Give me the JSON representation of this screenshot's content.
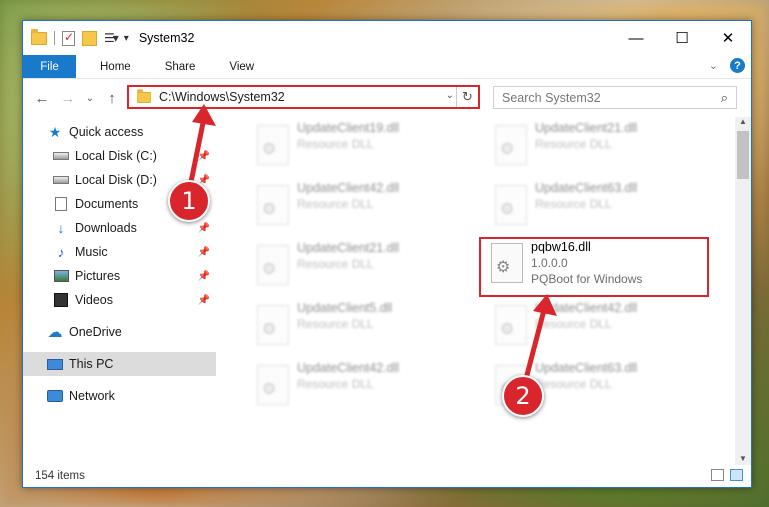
{
  "window": {
    "title": "System32"
  },
  "ribbon": {
    "tabs": [
      "File",
      "Home",
      "Share",
      "View"
    ]
  },
  "address": {
    "path": "C:\\Windows\\System32"
  },
  "search": {
    "placeholder": "Search System32"
  },
  "sidebar": {
    "items": [
      {
        "label": "Quick access",
        "icon": "star-icon",
        "pinned": false
      },
      {
        "label": "Local Disk (C:)",
        "icon": "drive-icon",
        "pinned": true
      },
      {
        "label": "Local Disk (D:)",
        "icon": "drive-icon",
        "pinned": true
      },
      {
        "label": "Documents",
        "icon": "documents-icon",
        "pinned": true
      },
      {
        "label": "Downloads",
        "icon": "downloads-icon",
        "pinned": true
      },
      {
        "label": "Music",
        "icon": "music-icon",
        "pinned": true
      },
      {
        "label": "Pictures",
        "icon": "pictures-icon",
        "pinned": true
      },
      {
        "label": "Videos",
        "icon": "videos-icon",
        "pinned": true
      },
      {
        "label": "OneDrive",
        "icon": "onedrive-icon",
        "pinned": false
      },
      {
        "label": "This PC",
        "icon": "this-pc-icon",
        "pinned": false
      },
      {
        "label": "Network",
        "icon": "network-icon",
        "pinned": false
      }
    ]
  },
  "files": [
    {
      "name": "UpdateClient19.dll",
      "sub": "Resource DLL"
    },
    {
      "name": "UpdateClient21.dll",
      "sub": "Resource DLL"
    },
    {
      "name": "UpdateClient42.dll",
      "sub": "Resource DLL"
    },
    {
      "name": "UpdateClient63.dll",
      "sub": "Resource DLL"
    },
    {
      "name": "UpdateClient21.dll",
      "sub": "Resource DLL"
    },
    {
      "name": "pqbw16.dll",
      "sub": "1.0.0.0",
      "sub2": "PQBoot for Windows"
    },
    {
      "name": "UpdateClient5.dll",
      "sub": "Resource DLL"
    },
    {
      "name": "UpdateClient42.dll",
      "sub": "Resource DLL"
    },
    {
      "name": "UpdateClient42.dll",
      "sub": "Resource DLL"
    },
    {
      "name": "UpdateClient63.dll",
      "sub": "Resource DLL"
    }
  ],
  "status": {
    "item_count": "154 items"
  },
  "annotations": {
    "step1": "1",
    "step2": "2",
    "color": "#d9262c"
  }
}
